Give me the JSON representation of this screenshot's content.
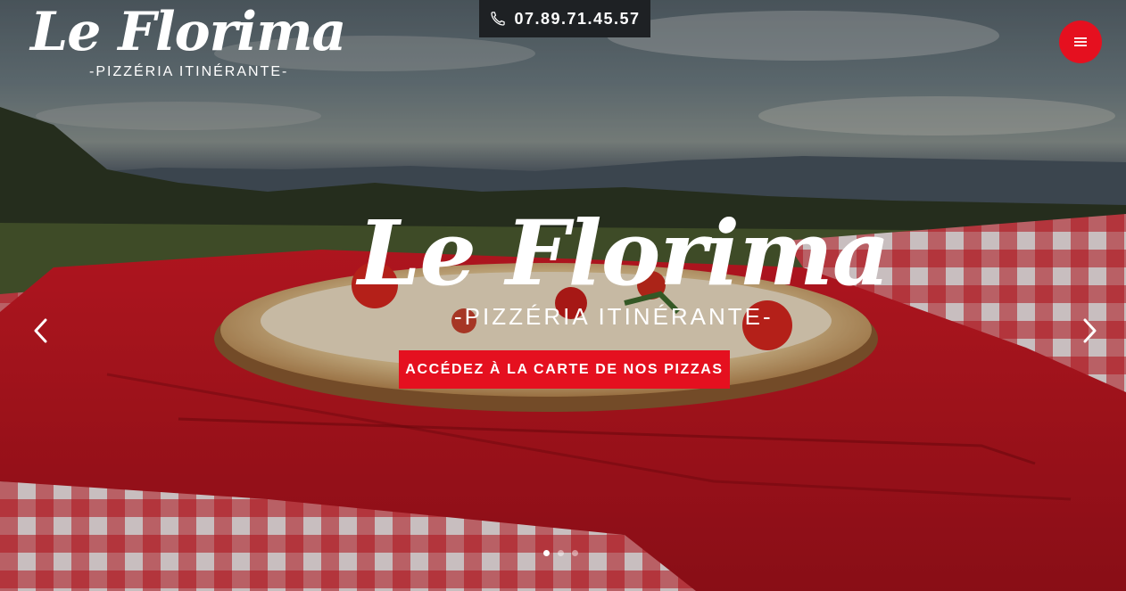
{
  "header": {
    "logo_script": "Le Florima",
    "logo_tagline": "-PIZZÉRIA ITINÉRANTE-",
    "phone_number": "07.89.71.45.57",
    "menu_icon": "hamburger-icon"
  },
  "hero": {
    "logo_script": "Le Florima",
    "logo_tagline": "-PIZZÉRIA ITINÉRANTE-",
    "cta_label": "ACCÉDEZ À LA CARTE DE NOS PIZZAS",
    "prev_icon": "chevron-left-icon",
    "next_icon": "chevron-right-icon",
    "slide_count": 3,
    "active_slide": 1
  },
  "colors": {
    "accent": "#e5101f",
    "phone_bar": "#1e2124"
  }
}
